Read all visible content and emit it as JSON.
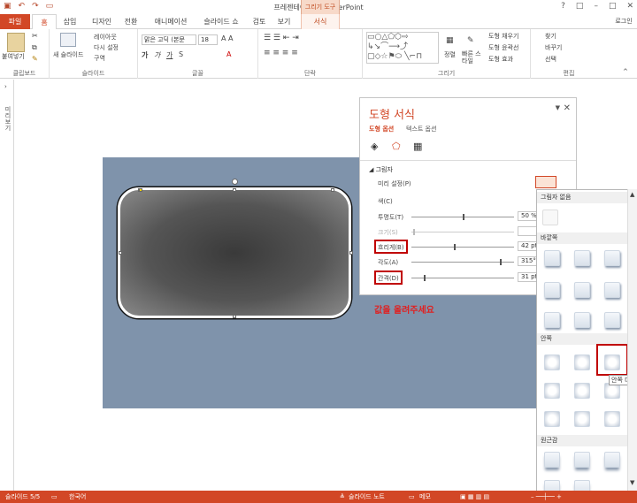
{
  "titlebar": {
    "title": "프레젠테이션2 - PowerPoint",
    "tool_group": "그리기 도구",
    "qat": [
      "save-icon",
      "undo-icon",
      "redo-icon",
      "slideshow-icon"
    ],
    "window_controls": [
      "?",
      "□",
      "–",
      "□",
      "✕"
    ]
  },
  "tabs": [
    "파일",
    "홈",
    "삽입",
    "디자인",
    "전환",
    "애니메이션",
    "슬라이드 쇼",
    "검토",
    "보기",
    "서식"
  ],
  "user": "로그인",
  "ribbon": {
    "clipboard": {
      "paste": "붙여넣기",
      "label": "클립보드"
    },
    "slides": {
      "new_slide": "새 슬라이드",
      "layout": "레이아웃",
      "reset": "다시 설정",
      "section": "구역",
      "label": "슬라이드"
    },
    "font": {
      "font_name": "맑은 고딕 (본문",
      "font_size": "18",
      "label": "글꼴"
    },
    "paragraph": {
      "label": "단락"
    },
    "drawing": {
      "arrange": "정렬",
      "quick_styles": "빠른 스타일",
      "fill": "도형 채우기",
      "outline": "도형 윤곽선",
      "effects": "도형 효과",
      "label": "그리기"
    },
    "editing": {
      "find": "찾기",
      "replace": "바꾸기",
      "select": "선택",
      "label": "편집"
    }
  },
  "left_strip_label": "미리보기",
  "annotation": "값을 올려주세요",
  "pane": {
    "title": "도형 서식",
    "tab_shape": "도형 옵션",
    "tab_text": "텍스트 옵션",
    "section": "그림자",
    "preset_label": "미리 설정(P)",
    "color_label": "색(C)",
    "transparency_label": "투명도(T)",
    "transparency_value": "50 %",
    "size_label": "크기(S)",
    "size_value": "",
    "blur_label": "흐리게(B)",
    "blur_value": "42 pt",
    "angle_label": "각도(A)",
    "angle_value": "315°",
    "distance_label": "간격(D)",
    "distance_value": "31 pt"
  },
  "gallery": {
    "no_shadow": "그림자 없음",
    "outer": "바깥쪽",
    "inner": "안쪽",
    "perspective": "원근감",
    "tooltip": "안쪽 대각"
  },
  "status": {
    "slide": "슬라이드 5/5",
    "language": "한국어",
    "notes": "슬라이드 노트",
    "comments": "메모"
  },
  "colors": {
    "accent": "#d24726",
    "slide_bg": "#7f93ab",
    "highlight": "#c00000",
    "annotation": "#e02020"
  }
}
